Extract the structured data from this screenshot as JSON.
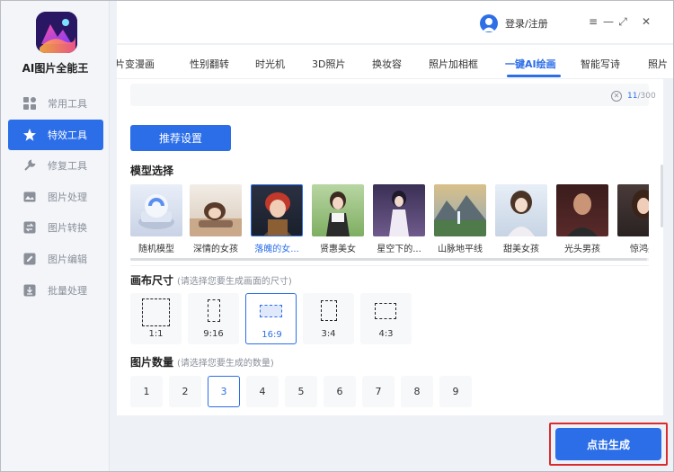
{
  "app": {
    "title": "AI图片全能王"
  },
  "sidebar": {
    "items": [
      {
        "label": "常用工具",
        "icon": "grid-icon",
        "active": false
      },
      {
        "label": "特效工具",
        "icon": "star-icon",
        "active": true
      },
      {
        "label": "修复工具",
        "icon": "repair-icon",
        "active": false
      },
      {
        "label": "图片处理",
        "icon": "image-icon",
        "active": false
      },
      {
        "label": "图片转换",
        "icon": "convert-icon",
        "active": false
      },
      {
        "label": "图片编辑",
        "icon": "edit-icon",
        "active": false
      },
      {
        "label": "批量处理",
        "icon": "batch-icon",
        "active": false
      }
    ]
  },
  "titlebar": {
    "login_label": "登录/注册",
    "menu_icon": "≡",
    "minimize_icon": "—",
    "maximize_icon": "⤢",
    "close_icon": "✕"
  },
  "tabs": [
    {
      "label": "照片变漫画",
      "active": false
    },
    {
      "label": "性别翻转",
      "active": false
    },
    {
      "label": "时光机",
      "active": false
    },
    {
      "label": "3D照片",
      "active": false
    },
    {
      "label": "换妆容",
      "active": false
    },
    {
      "label": "照片加相框",
      "active": false
    },
    {
      "label": "一键AI绘画",
      "active": true
    },
    {
      "label": "智能写诗",
      "active": false
    },
    {
      "label": "照片",
      "active": false
    }
  ],
  "prompt": {
    "current_count": "11",
    "max_count": "/300"
  },
  "recommend_button": "推荐设置",
  "model_section": {
    "title": "模型选择",
    "models": [
      {
        "label": "随机模型",
        "selected": false
      },
      {
        "label": "深情的女孩",
        "selected": false
      },
      {
        "label": "落魄的女...",
        "selected": true
      },
      {
        "label": "贤惠美女",
        "selected": false
      },
      {
        "label": "星空下的...",
        "selected": false
      },
      {
        "label": "山脉地平线",
        "selected": false
      },
      {
        "label": "甜美女孩",
        "selected": false
      },
      {
        "label": "光头男孩",
        "selected": false
      },
      {
        "label": "惊鸿美",
        "selected": false
      }
    ]
  },
  "canvas_section": {
    "title": "画布尺寸",
    "hint": "(请选择您要生成画面的尺寸)",
    "sizes": [
      {
        "label": "1:1",
        "selected": false
      },
      {
        "label": "9:16",
        "selected": false
      },
      {
        "label": "16:9",
        "selected": true
      },
      {
        "label": "3:4",
        "selected": false
      },
      {
        "label": "4:3",
        "selected": false
      }
    ]
  },
  "count_section": {
    "title": "图片数量",
    "hint": "(请选择您要生成的数量)",
    "counts": [
      "1",
      "2",
      "3",
      "4",
      "5",
      "6",
      "7",
      "8",
      "9"
    ],
    "selected": "3"
  },
  "generate_button": "点击生成",
  "colors": {
    "accent": "#2b6ee8",
    "highlight": "#d92c2c"
  }
}
